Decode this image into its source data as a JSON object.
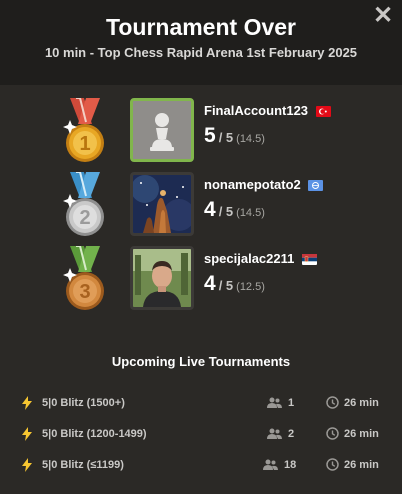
{
  "header": {
    "title": "Tournament Over",
    "subtitle": "10 min - Top Chess Rapid Arena 1st February 2025",
    "close_icon": "close-icon"
  },
  "podium": [
    {
      "place": "1",
      "medal": "gold-medal-icon",
      "username": "FinalAccount123",
      "flag": "turkey-flag-icon",
      "score": "5",
      "out_of": "/ 5",
      "tiebreak": "(14.5)",
      "avatar": "pawn-default-avatar"
    },
    {
      "place": "2",
      "medal": "silver-medal-icon",
      "username": "nonamepotato2",
      "flag": "international-flag-icon",
      "score": "4",
      "out_of": "/ 5",
      "tiebreak": "(14.5)",
      "avatar": "nebula-photo-avatar"
    },
    {
      "place": "3",
      "medal": "bronze-medal-icon",
      "username": "specijalac2211",
      "flag": "serbia-flag-icon",
      "score": "4",
      "out_of": "/ 5",
      "tiebreak": "(12.5)",
      "avatar": "person-photo-avatar"
    }
  ],
  "upcoming": {
    "title": "Upcoming Live Tournaments",
    "tournaments": [
      {
        "name": "5|0 Blitz (1500+)",
        "players": "1",
        "starts_in": "26 min"
      },
      {
        "name": "5|0 Blitz (1200-1499)",
        "players": "2",
        "starts_in": "26 min"
      },
      {
        "name": "5|0 Blitz (≤1199)",
        "players": "18",
        "starts_in": "26 min"
      }
    ]
  },
  "colors": {
    "gold": "#e8a724",
    "silver": "#c9c9c9",
    "bronze": "#d2883e",
    "bolt": "#f7c631",
    "highlight_border": "#81b64c"
  }
}
